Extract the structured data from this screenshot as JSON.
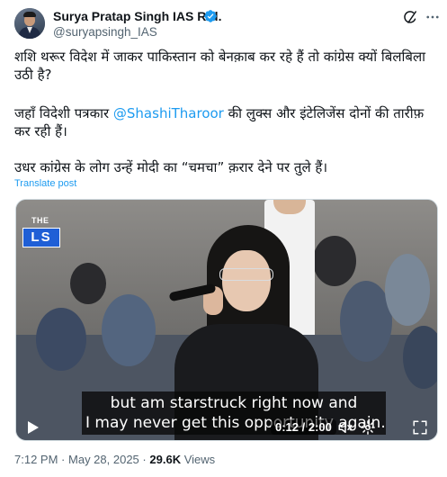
{
  "author": {
    "display_name": "Surya Pratap Singh IAS Rtd.",
    "handle": "@suryapsingh_IAS",
    "verified_color": "#1d9bf0"
  },
  "header_icons": [
    "grok-icon",
    "more-icon"
  ],
  "tweet": {
    "paragraph1": "शशि थरूर विदेश में जाकर पाकिस्तान को बेनक़ाब कर रहे हैं तो कांग्रेस क्यों बिलबिला उठी है?",
    "paragraph2_before": "जहाँ विदेशी पत्रकार ",
    "paragraph2_mention": "@ShashiTharoor",
    "paragraph2_after": " की लुक्स और इंटेलिजेंस दोनों की तारीफ़ कर रही हैं।",
    "paragraph3": "उधर कांग्रेस के लोग उन्हें मोदी का “चमचा” क़रार देने पर तुले हैं।",
    "translate_label": "Translate post"
  },
  "video": {
    "channel_logo_top": "THE",
    "channel_logo_main": "LS",
    "caption_line1": "but am starstruck right now and",
    "caption_line2": "I may never get this opportunity again.",
    "time": "0:12 / 2:00",
    "playing": false
  },
  "footer": {
    "time": "7:12 PM",
    "separator": "·",
    "date": "May 28, 2025",
    "views_count": "29.6K",
    "views_label": "Views"
  },
  "colors": {
    "accent": "#1d9bf0",
    "text": "#0f1419",
    "muted": "#536471"
  }
}
